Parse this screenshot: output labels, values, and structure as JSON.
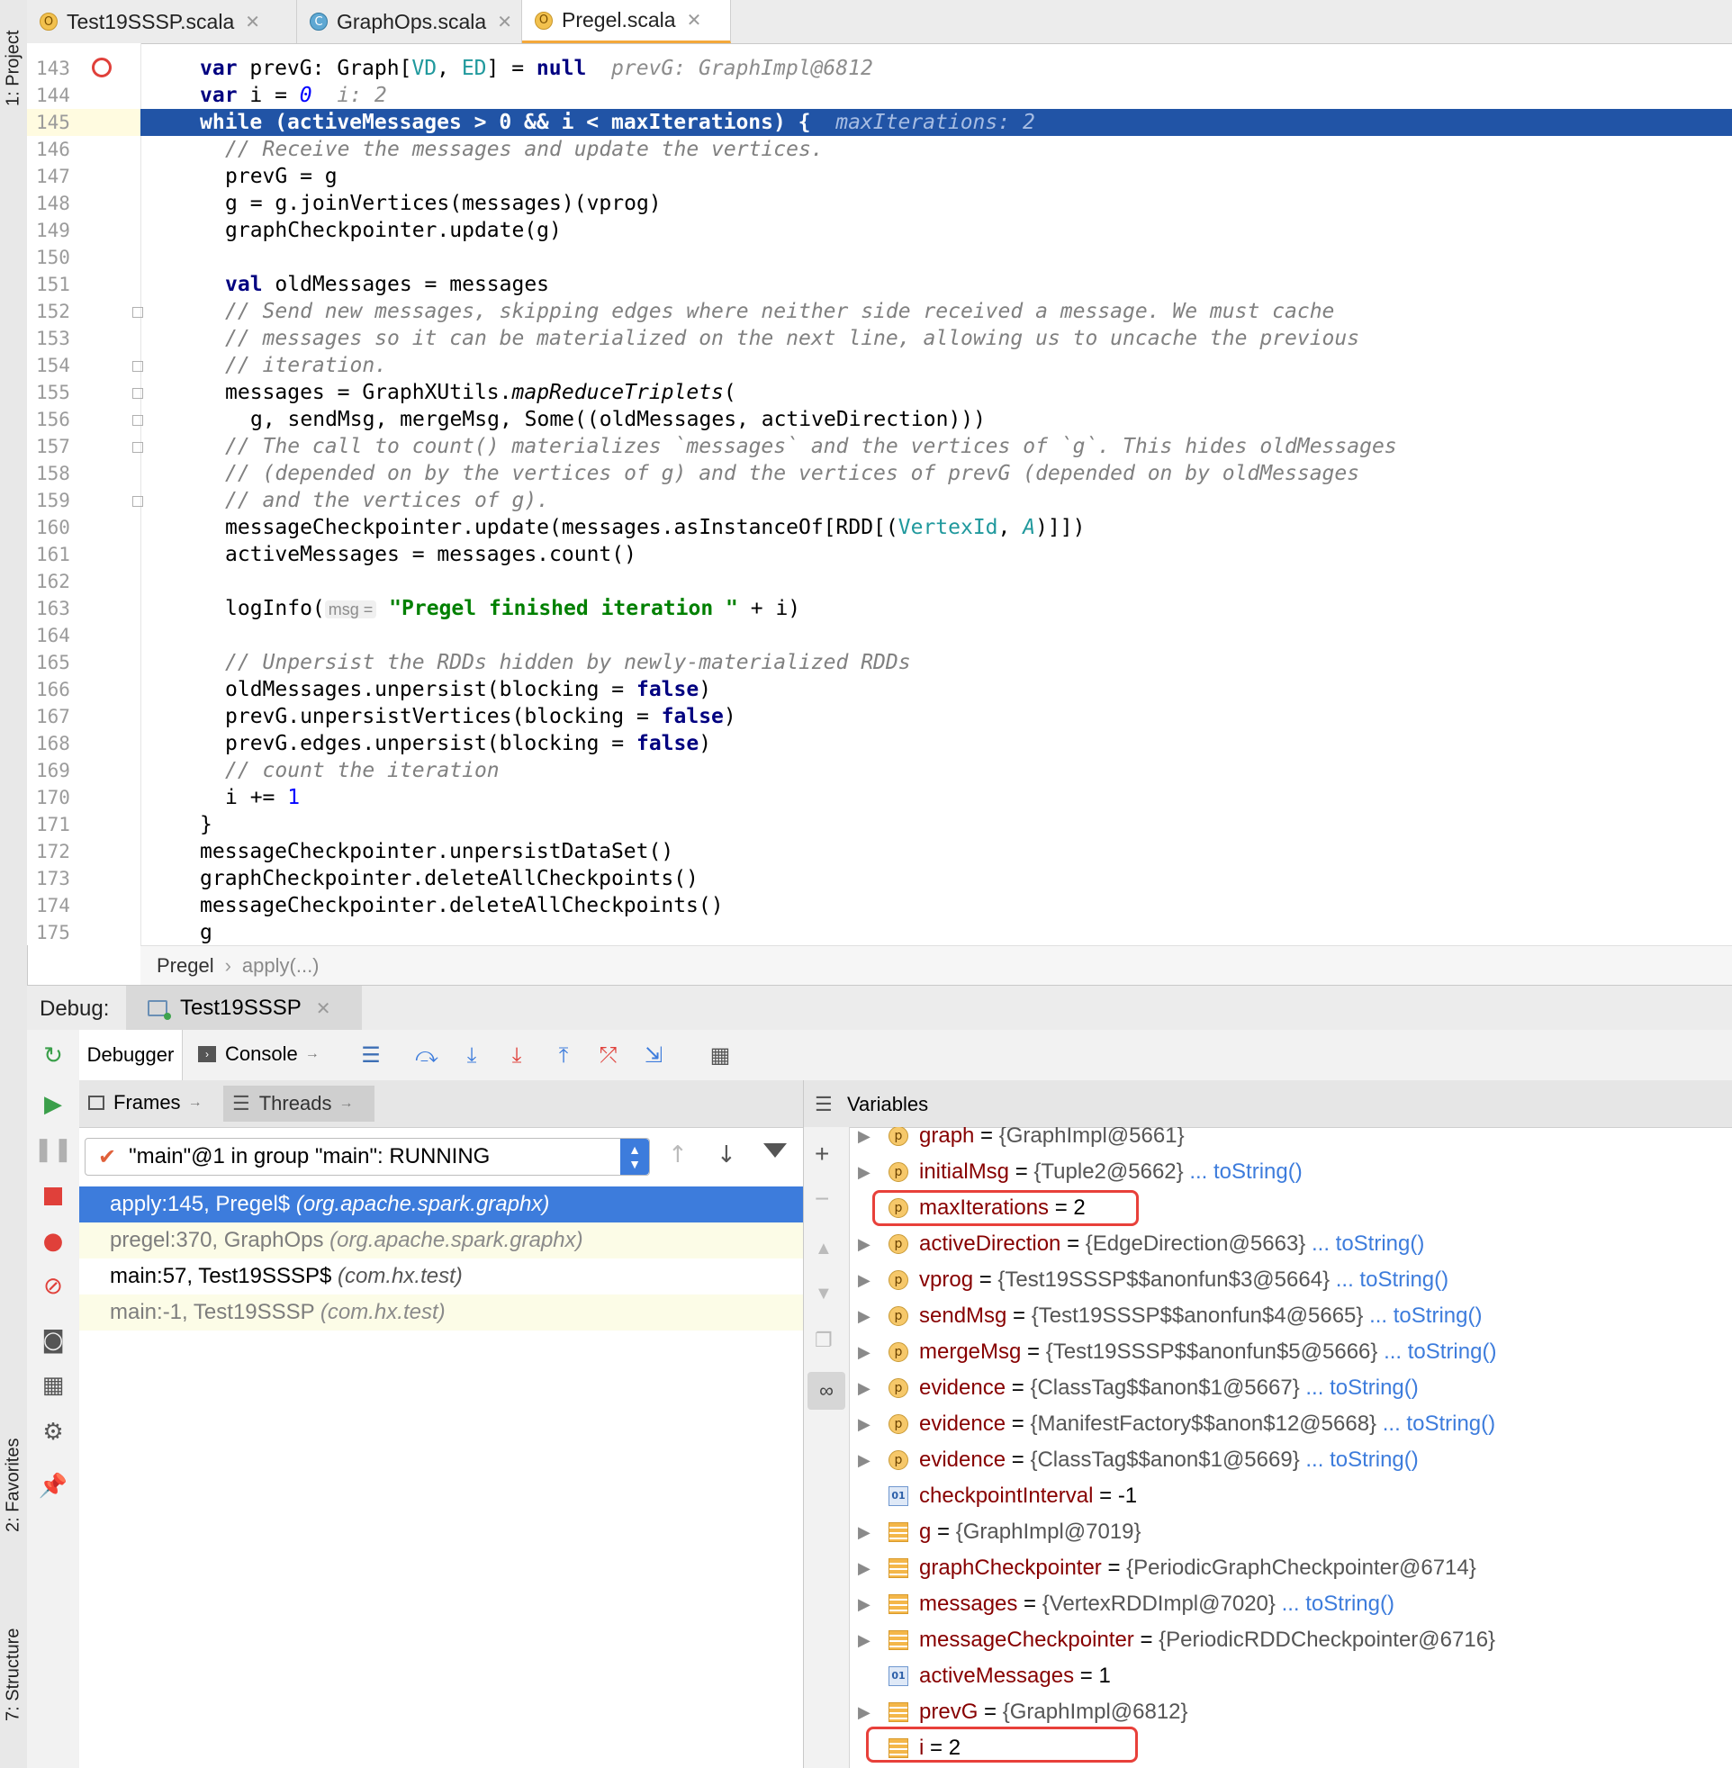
{
  "tool_strip": {
    "project": "1: Project",
    "favorites": "2: Favorites",
    "structure": "7: Structure"
  },
  "tabs": [
    {
      "label": "Test19SSSP.scala",
      "icon": "O"
    },
    {
      "label": "GraphOps.scala",
      "icon": "C"
    },
    {
      "label": "Pregel.scala",
      "icon": "O"
    }
  ],
  "editor": {
    "line_numbers": [
      "143",
      "144",
      "145",
      "146",
      "147",
      "148",
      "149",
      "150",
      "151",
      "152",
      "153",
      "154",
      "155",
      "156",
      "157",
      "158",
      "159",
      "160",
      "161",
      "162",
      "163",
      "164",
      "165",
      "166",
      "167",
      "168",
      "169",
      "170",
      "171",
      "172",
      "173",
      "174",
      "175"
    ],
    "hints": {
      "prevG": "prevG: GraphImpl@6812",
      "i": "i: 2",
      "maxIterations": "maxIterations: 2",
      "msg": "msg ="
    },
    "lines": {
      "l143_pre": "var",
      "l143_b": " prevG: Graph[",
      "l143_vd": "VD",
      "l143_c": ", ",
      "l143_ed": "ED",
      "l143_d": "] = ",
      "l143_null": "null",
      "l144_var": "var",
      "l144_b": " i = ",
      "l144_0": "0",
      "l145_while": "while",
      "l145_rest": " (activeMessages > 0 && i < maxIterations) {",
      "l146": "// Receive the messages and update the vertices.",
      "l147": "prevG = g",
      "l148": "g = g.joinVertices(messages)(vprog)",
      "l149": "graphCheckpointer.update(g)",
      "l151_val": "val",
      "l151_rest": " oldMessages = messages",
      "l152": "// Send new messages, skipping edges where neither side received a message. We must cache",
      "l153": "// messages so it can be materialized on the next line, allowing us to uncache the previous",
      "l154": "// iteration.",
      "l155_a": "messages = GraphXUtils.",
      "l155_b": "mapReduceTriplets",
      "l155_c": "(",
      "l156": "g, sendMsg, mergeMsg, Some((oldMessages, activeDirection)))",
      "l157": "// The call to count() materializes `messages` and the vertices of `g`. This hides oldMessages",
      "l158": "// (depended on by the vertices of g) and the vertices of prevG (depended on by oldMessages",
      "l159": "// and the vertices of g).",
      "l160_a": "messageCheckpointer.update(messages.asInstanceOf[RDD[(",
      "l160_vid": "VertexId",
      "l160_c": ", ",
      "l160_A": "A",
      "l160_d": ")]])",
      "l161": "activeMessages = messages.count()",
      "l163_a": "logInfo(",
      "l163_str": "\"Pregel finished iteration \"",
      "l163_c": " + i)",
      "l165": "// Unpersist the RDDs hidden by newly-materialized RDDs",
      "l166_a": "oldMessages.unpersist(blocking = ",
      "l166_f": "false",
      "l166_c": ")",
      "l167_a": "prevG.unpersistVertices(blocking = ",
      "l167_f": "false",
      "l167_c": ")",
      "l168_a": "prevG.edges.unpersist(blocking = ",
      "l168_f": "false",
      "l168_c": ")",
      "l169": "// count the iteration",
      "l170_a": "i += ",
      "l170_1": "1",
      "l171": "}",
      "l172": "messageCheckpointer.unpersistDataSet()",
      "l173": "graphCheckpointer.deleteAllCheckpoints()",
      "l174": "messageCheckpointer.deleteAllCheckpoints()",
      "l175": "g"
    }
  },
  "breadcrumb": {
    "item1": "Pregel",
    "sep": "›",
    "item2": "apply(...)"
  },
  "debug": {
    "label": "Debug:",
    "session_tab": "Test19SSSP",
    "debugger_tab": "Debugger",
    "console_tab": "Console",
    "frames_tab": "Frames",
    "threads_tab": "Threads",
    "variables_label": "Variables",
    "thread_selector": "\"main\"@1 in group \"main\": RUNNING",
    "frames": [
      {
        "loc": "apply:145, Pregel$",
        "pkg": "(org.apache.spark.graphx)"
      },
      {
        "loc": "pregel:370, GraphOps",
        "pkg": "(org.apache.spark.graphx)"
      },
      {
        "loc": "main:57, Test19SSSP$",
        "pkg": "(com.hx.test)"
      },
      {
        "loc": "main:-1, Test19SSSP",
        "pkg": "(com.hx.test)"
      }
    ],
    "variables": [
      {
        "name": "graph",
        "value": "{GraphImpl@5661}",
        "link": "",
        "kind": "p"
      },
      {
        "name": "initialMsg",
        "value": "{Tuple2@5662}",
        "link": "... toString()",
        "kind": "p"
      },
      {
        "name": "maxIterations",
        "value": "2",
        "link": "",
        "kind": "p"
      },
      {
        "name": "activeDirection",
        "value": "{EdgeDirection@5663}",
        "link": "... toString()",
        "kind": "p"
      },
      {
        "name": "vprog",
        "value": "{Test19SSSP$$anonfun$3@5664}",
        "link": "... toString()",
        "kind": "p"
      },
      {
        "name": "sendMsg",
        "value": "{Test19SSSP$$anonfun$4@5665}",
        "link": "... toString()",
        "kind": "p"
      },
      {
        "name": "mergeMsg",
        "value": "{Test19SSSP$$anonfun$5@5666}",
        "link": "... toString()",
        "kind": "p"
      },
      {
        "name": "evidence",
        "value": "{ClassTag$$anon$1@5667}",
        "link": "... toString()",
        "kind": "p"
      },
      {
        "name": "evidence",
        "value": "{ManifestFactory$$anon$12@5668}",
        "link": "... toString()",
        "kind": "p"
      },
      {
        "name": "evidence",
        "value": "{ClassTag$$anon$1@5669}",
        "link": "... toString()",
        "kind": "p"
      },
      {
        "name": "checkpointInterval",
        "value": "-1",
        "link": "",
        "kind": "o"
      },
      {
        "name": "g",
        "value": "{GraphImpl@7019}",
        "link": "",
        "kind": "f"
      },
      {
        "name": "graphCheckpointer",
        "value": "{PeriodicGraphCheckpointer@6714}",
        "link": "",
        "kind": "f"
      },
      {
        "name": "messages",
        "value": "{VertexRDDImpl@7020}",
        "link": "... toString()",
        "kind": "f"
      },
      {
        "name": "messageCheckpointer",
        "value": "{PeriodicRDDCheckpointer@6716}",
        "link": "",
        "kind": "f"
      },
      {
        "name": "activeMessages",
        "value": "1",
        "link": "",
        "kind": "o"
      },
      {
        "name": "prevG",
        "value": "{GraphImpl@6812}",
        "link": "",
        "kind": "f"
      },
      {
        "name": "i",
        "value": "2",
        "link": "",
        "kind": "f"
      }
    ]
  },
  "colors": {
    "selection": "#2154a6",
    "frame_selected": "#3d7cdc",
    "highlight_box": "#e8403a",
    "keyword": "#000080",
    "string": "#008000"
  }
}
